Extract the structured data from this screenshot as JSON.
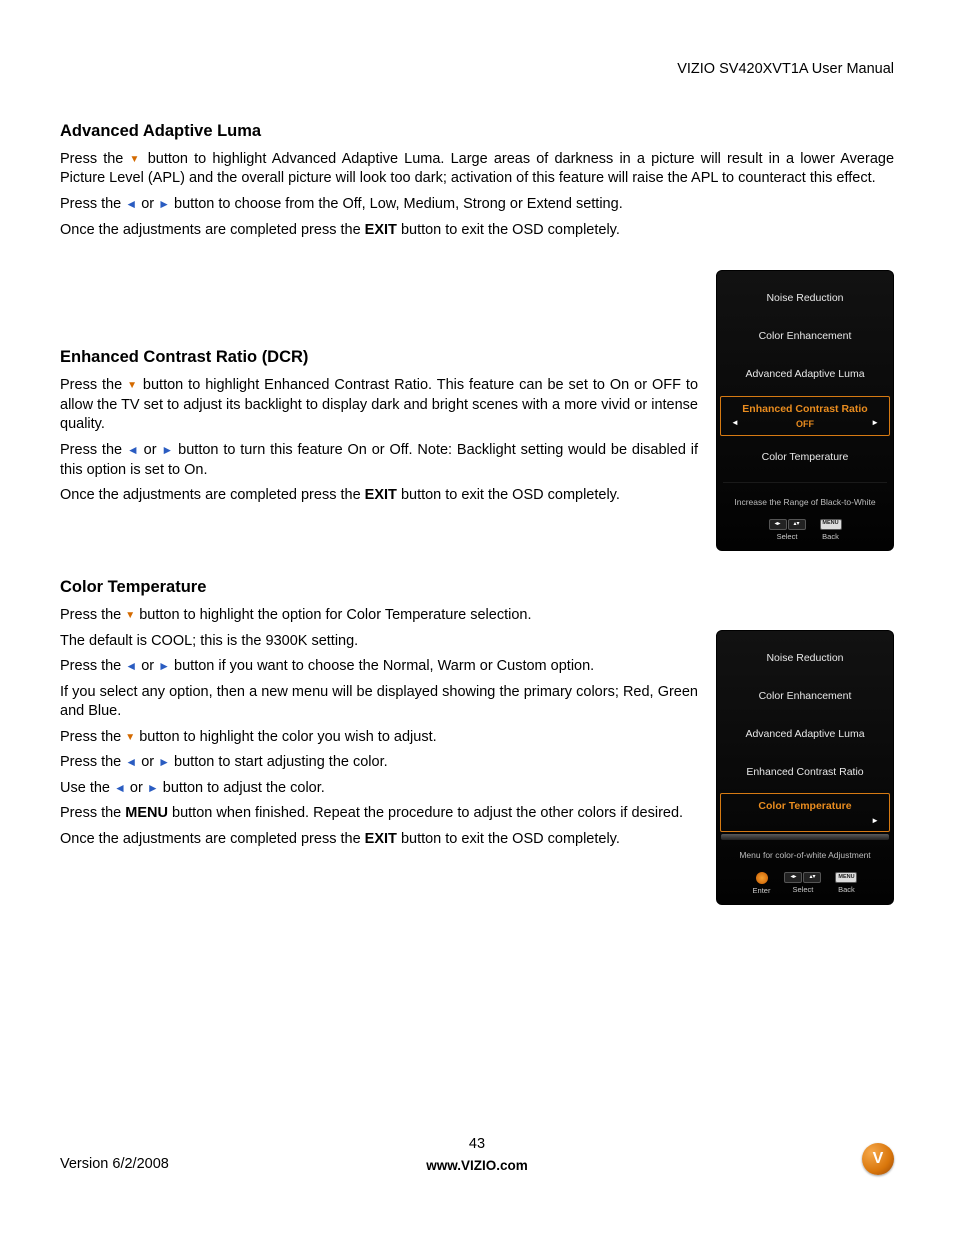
{
  "header": {
    "doc_title": "VIZIO SV420XVT1A User Manual"
  },
  "sections": {
    "luma": {
      "title": "Advanced Adaptive Luma",
      "p1a": "Press the ",
      "p1b": " button to highlight Advanced Adaptive Luma. Large areas of darkness in a picture will result in a lower Average Picture Level (APL) and the overall picture will look too dark; activation of this feature will raise the APL to counteract this effect.",
      "p2a": "Press the ",
      "p2mid": " or ",
      "p2b": " button to choose from the Off, Low, Medium, Strong or Extend setting.",
      "p3a": "Once the adjustments are completed press the ",
      "p3exit": "EXIT",
      "p3b": " button to exit the OSD completely."
    },
    "dcr": {
      "title": "Enhanced Contrast Ratio (DCR)",
      "p1a": "Press the ",
      "p1b": " button to highlight Enhanced Contrast Ratio.  This feature can be set to On or OFF to allow the TV set to adjust its backlight to display dark and bright scenes with a more vivid or intense quality.",
      "p2a": "Press the ",
      "p2mid": " or ",
      "p2b": " button to turn this feature On or Off. Note: Backlight setting would be disabled if this option is set to On.",
      "p3a": "Once the adjustments are completed press the ",
      "p3exit": "EXIT",
      "p3b": " button to exit the OSD completely."
    },
    "ctemp": {
      "title": "Color Temperature",
      "p1a": "Press the ",
      "p1b": " button to highlight the option for Color Temperature selection.",
      "p2": "The default is COOL; this is the 9300K setting.",
      "p3a": "Press the ",
      "p3mid": " or ",
      "p3b": " button if you want to choose the Normal, Warm or Custom option.",
      "p4": "If you select any option, then a new menu will be displayed showing the primary colors; Red, Green and Blue.",
      "p5a": "Press the ",
      "p5b": " button to highlight the color you wish to adjust.",
      "p6a": "Press the ",
      "p6mid": " or ",
      "p6b": "button to start adjusting the color.",
      "p7a": "Use the ",
      "p7mid": " or ",
      "p7b": "button to adjust the color.",
      "p8a": "Press the ",
      "p8menu": "MENU",
      "p8b": " button when finished.  Repeat the procedure to adjust the other colors if desired.",
      "p9a": "Once the adjustments are completed press the ",
      "p9exit": "EXIT",
      "p9b": " button to exit the OSD completely."
    }
  },
  "osd1": {
    "items": [
      "Noise Reduction",
      "Color Enhancement",
      "Advanced Adaptive Luma"
    ],
    "selected_title": "Enhanced Contrast Ratio",
    "selected_value": "OFF",
    "after": [
      "Color Temperature"
    ],
    "hint": "Increase the Range of Black-to-White",
    "foot_select": "Select",
    "foot_back": "Back",
    "foot_menu": "MENU"
  },
  "osd2": {
    "items": [
      "Noise Reduction",
      "Color Enhancement",
      "Advanced Adaptive Luma",
      "Enhanced Contrast Ratio"
    ],
    "selected_title": "Color Temperature",
    "hint": "Menu  for color-of-white Adjustment",
    "foot_enter": "Enter",
    "foot_select": "Select",
    "foot_back": "Back",
    "foot_menu": "MENU"
  },
  "footer": {
    "version": "Version 6/2/2008",
    "page": "43",
    "site": "www.VIZIO.com",
    "logo_letter": "V"
  }
}
